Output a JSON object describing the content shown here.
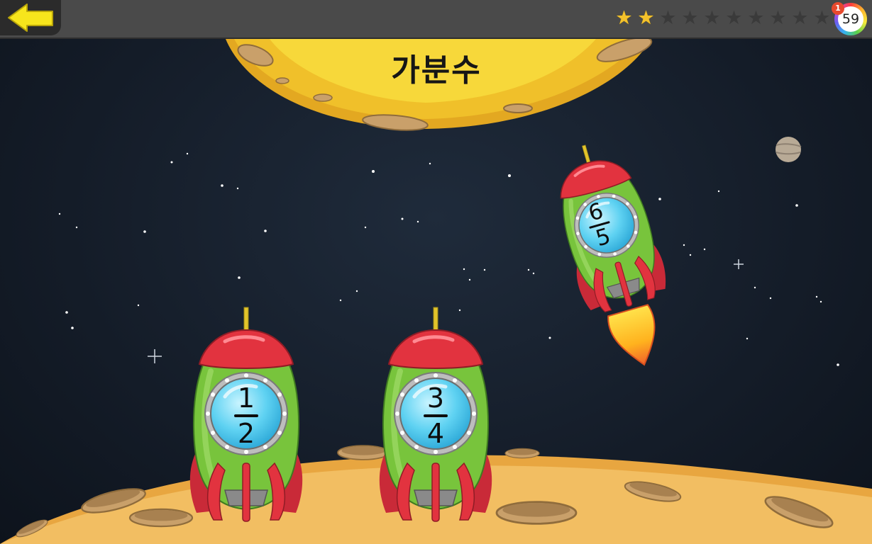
{
  "title": "가분수",
  "stars": {
    "filled": 2,
    "total": 10
  },
  "score": "59",
  "notification_count": "1",
  "rockets": [
    {
      "numerator": "1",
      "denominator": "2",
      "state": "landed"
    },
    {
      "numerator": "3",
      "denominator": "4",
      "state": "landed"
    },
    {
      "numerator": "6",
      "denominator": "5",
      "state": "launched"
    }
  ],
  "colors": {
    "moon": "#f0c02a",
    "ground": "#f2be62",
    "rocket_body": "#78c43c",
    "rocket_cap": "#e2333f",
    "window_glass": "#5fd2f2",
    "back_arrow": "#f7e51c"
  },
  "icons": {
    "back": "left-arrow-icon",
    "star": "star-icon"
  }
}
